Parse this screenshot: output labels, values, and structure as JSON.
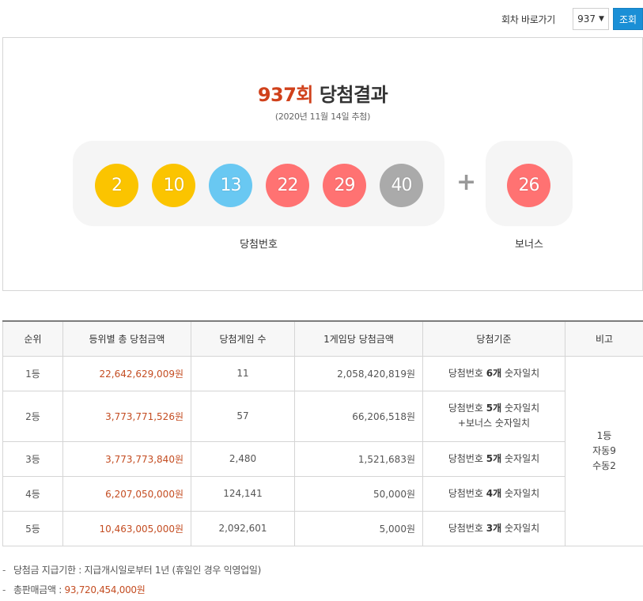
{
  "toolbar": {
    "goto_label": "회차 바로가기",
    "round_select_value": "937",
    "search_label": "조회"
  },
  "result": {
    "round": "937회",
    "title_suffix": " 당첨결과",
    "draw_date": "(2020년 11월 14일 추첨)",
    "numbers": [
      {
        "value": "2",
        "color": "#fbc400"
      },
      {
        "value": "10",
        "color": "#fbc400"
      },
      {
        "value": "13",
        "color": "#69c8f2"
      },
      {
        "value": "22",
        "color": "#ff7272"
      },
      {
        "value": "29",
        "color": "#ff7272"
      },
      {
        "value": "40",
        "color": "#aaaaaa"
      }
    ],
    "plus": "+",
    "bonus": {
      "value": "26",
      "color": "#ff7272"
    },
    "numbers_caption": "당첨번호",
    "bonus_caption": "보너스"
  },
  "table": {
    "headers": [
      "순위",
      "등위별 총 당첨금액",
      "당첨게임 수",
      "1게임당 당첨금액",
      "당첨기준",
      "비고"
    ],
    "rows": [
      {
        "rank": "1등",
        "total": "22,642,629,009원",
        "winners": "11",
        "per_game": "2,058,420,819원",
        "criteria_a": "당첨번호 ",
        "criteria_b": "6개",
        "criteria_c": " 숫자일치",
        "criteria_d": ""
      },
      {
        "rank": "2등",
        "total": "3,773,771,526원",
        "winners": "57",
        "per_game": "66,206,518원",
        "criteria_a": "당첨번호 ",
        "criteria_b": "5개",
        "criteria_c": " 숫자일치",
        "criteria_d": "+보너스 숫자일치"
      },
      {
        "rank": "3등",
        "total": "3,773,773,840원",
        "winners": "2,480",
        "per_game": "1,521,683원",
        "criteria_a": "당첨번호 ",
        "criteria_b": "5개",
        "criteria_c": " 숫자일치",
        "criteria_d": ""
      },
      {
        "rank": "4등",
        "total": "6,207,050,000원",
        "winners": "124,141",
        "per_game": "50,000원",
        "criteria_a": "당첨번호 ",
        "criteria_b": "4개",
        "criteria_c": " 숫자일치",
        "criteria_d": ""
      },
      {
        "rank": "5등",
        "total": "10,463,005,000원",
        "winners": "2,092,601",
        "per_game": "5,000원",
        "criteria_a": "당첨번호 ",
        "criteria_b": "3개",
        "criteria_c": " 숫자일치",
        "criteria_d": ""
      }
    ],
    "remarks": [
      "1등",
      "자동9",
      "수동2"
    ]
  },
  "notes": {
    "dash": "-",
    "payment_deadline": "당첨금 지급기한 : 지급개시일로부터 1년 (휴일인 경우 익영업일)",
    "total_sales_label": "총판매금액 : ",
    "total_sales_value": "93,720,454,000원"
  },
  "colors": {
    "accent_red": "#c44d22",
    "round_red": "#d0411b",
    "button_blue": "#1a8fd6"
  }
}
